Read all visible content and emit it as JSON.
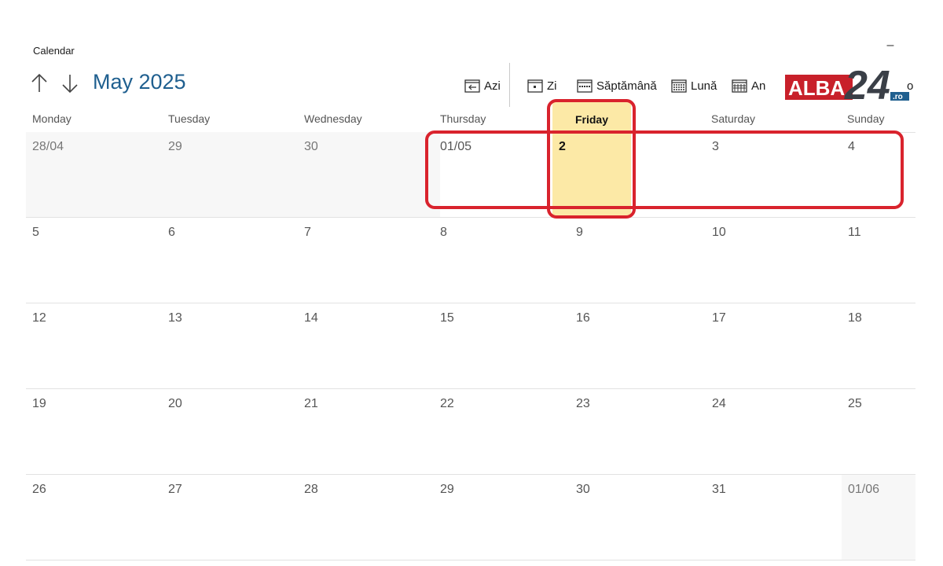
{
  "app": {
    "title": "Calendar",
    "minimize": "–"
  },
  "nav": {
    "month_label": "May 2025",
    "up_icon": "arrow-up-icon",
    "down_icon": "arrow-down-icon"
  },
  "toolbar": {
    "today": "Azi",
    "day": "Zi",
    "week": "Săptămână",
    "month": "Lună",
    "year": "An",
    "partial": "o"
  },
  "logo": {
    "text_main": "ALBA",
    "text_num": "24",
    "text_tld": ".ro"
  },
  "weekdays": [
    "Monday",
    "Tuesday",
    "Wednesday",
    "Thursday",
    "Friday",
    "Saturday",
    "Sunday"
  ],
  "today_weekday_index": 4,
  "weeks": [
    [
      "28/04",
      "29",
      "30",
      "01/05",
      "2",
      "3",
      "4"
    ],
    [
      "5",
      "6",
      "7",
      "8",
      "9",
      "10",
      "11"
    ],
    [
      "12",
      "13",
      "14",
      "15",
      "16",
      "17",
      "18"
    ],
    [
      "19",
      "20",
      "21",
      "22",
      "23",
      "24",
      "25"
    ],
    [
      "26",
      "27",
      "28",
      "29",
      "30",
      "31",
      "01/06"
    ]
  ],
  "colors": {
    "accent_text": "#1f5f8f",
    "today_bg": "#fce9a6",
    "annotation": "#d9232d",
    "logo_red": "#c8202a",
    "logo_dark": "#3a3f47"
  }
}
